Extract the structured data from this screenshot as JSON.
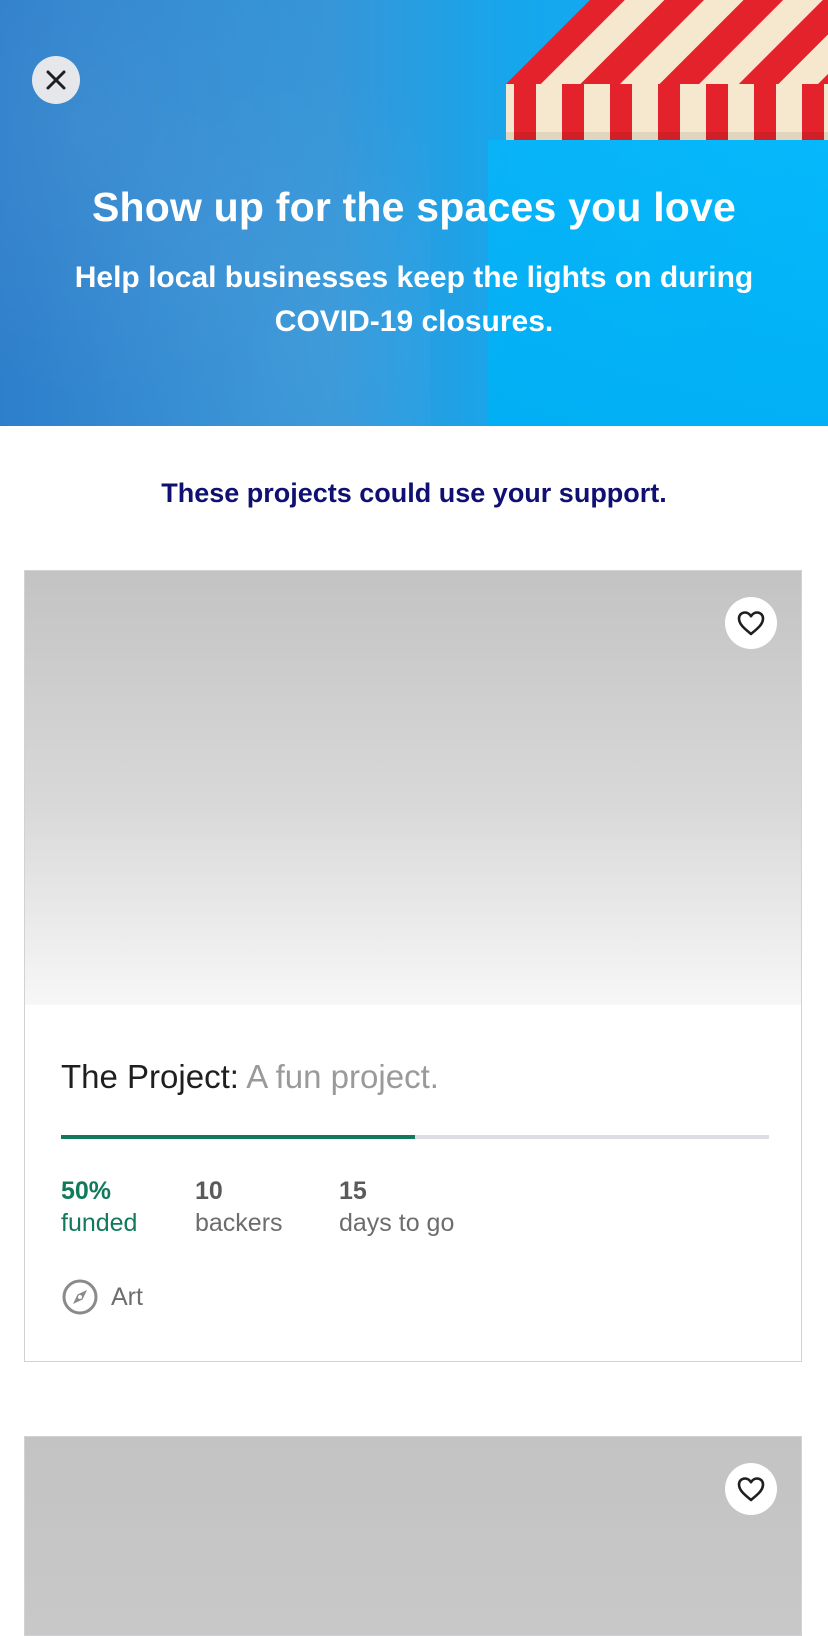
{
  "hero": {
    "title": "Show up for the spaces you love",
    "subtitle": "Help local businesses keep the lights on during COVID-19 closures.",
    "close_icon": "close-icon",
    "colors": {
      "gradient_start": "#2e7fcb",
      "gradient_end": "#0db4f6",
      "awning_red": "#e3222c",
      "awning_cream": "#f6e8cf"
    }
  },
  "section": {
    "heading": "These projects could use your support."
  },
  "projects": [
    {
      "name": "The Project:",
      "blurb": "A fun project.",
      "percent_funded": 50,
      "percent_label": "50%",
      "funded_label": "funded",
      "backers_count": "10",
      "backers_label": "backers",
      "days_count": "15",
      "days_label": "days to go",
      "category": "Art",
      "category_icon": "compass-icon",
      "favorite_icon": "heart-outline-icon"
    },
    {
      "favorite_icon": "heart-outline-icon"
    }
  ],
  "colors": {
    "section_heading": "#101072",
    "funded_green": "#117a5b",
    "progress_track": "#dcdde5"
  }
}
